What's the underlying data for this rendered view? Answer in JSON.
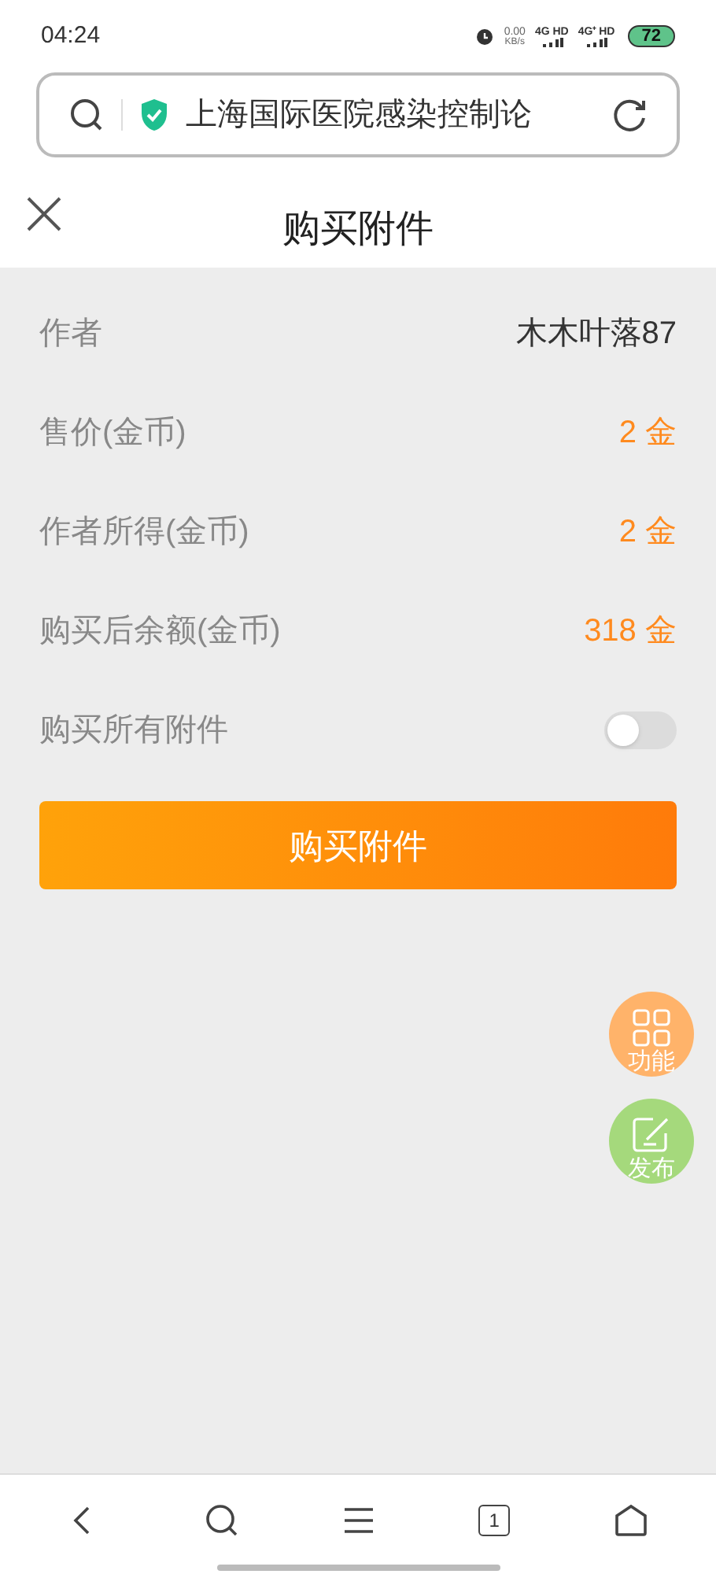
{
  "status_bar": {
    "time": "04:24",
    "speed": "0.00",
    "speed_unit": "KB/s",
    "sim_1": "4G HD",
    "sim_2": "4G⁺ HD",
    "battery": "72"
  },
  "address_bar": {
    "url": "上海国际医院感染控制论"
  },
  "header": {
    "title": "购买附件"
  },
  "rows": [
    {
      "kind": "plain",
      "label": "作者",
      "value": "木木叶落87"
    },
    {
      "kind": "coin",
      "label": "售价(金币)",
      "value": "2 金"
    },
    {
      "kind": "coin",
      "label": "作者所得(金币)",
      "value": "2 金"
    },
    {
      "kind": "coin",
      "label": "购买后余额(金币)",
      "value": "318 金"
    },
    {
      "kind": "toggle",
      "label": "购买所有附件",
      "on": false
    }
  ],
  "buy_button": "购买附件",
  "floating": [
    {
      "kind": "grid",
      "label": "功能"
    },
    {
      "kind": "edit",
      "label": "发布"
    }
  ],
  "bottom_nav": {
    "tab_count": "1"
  }
}
